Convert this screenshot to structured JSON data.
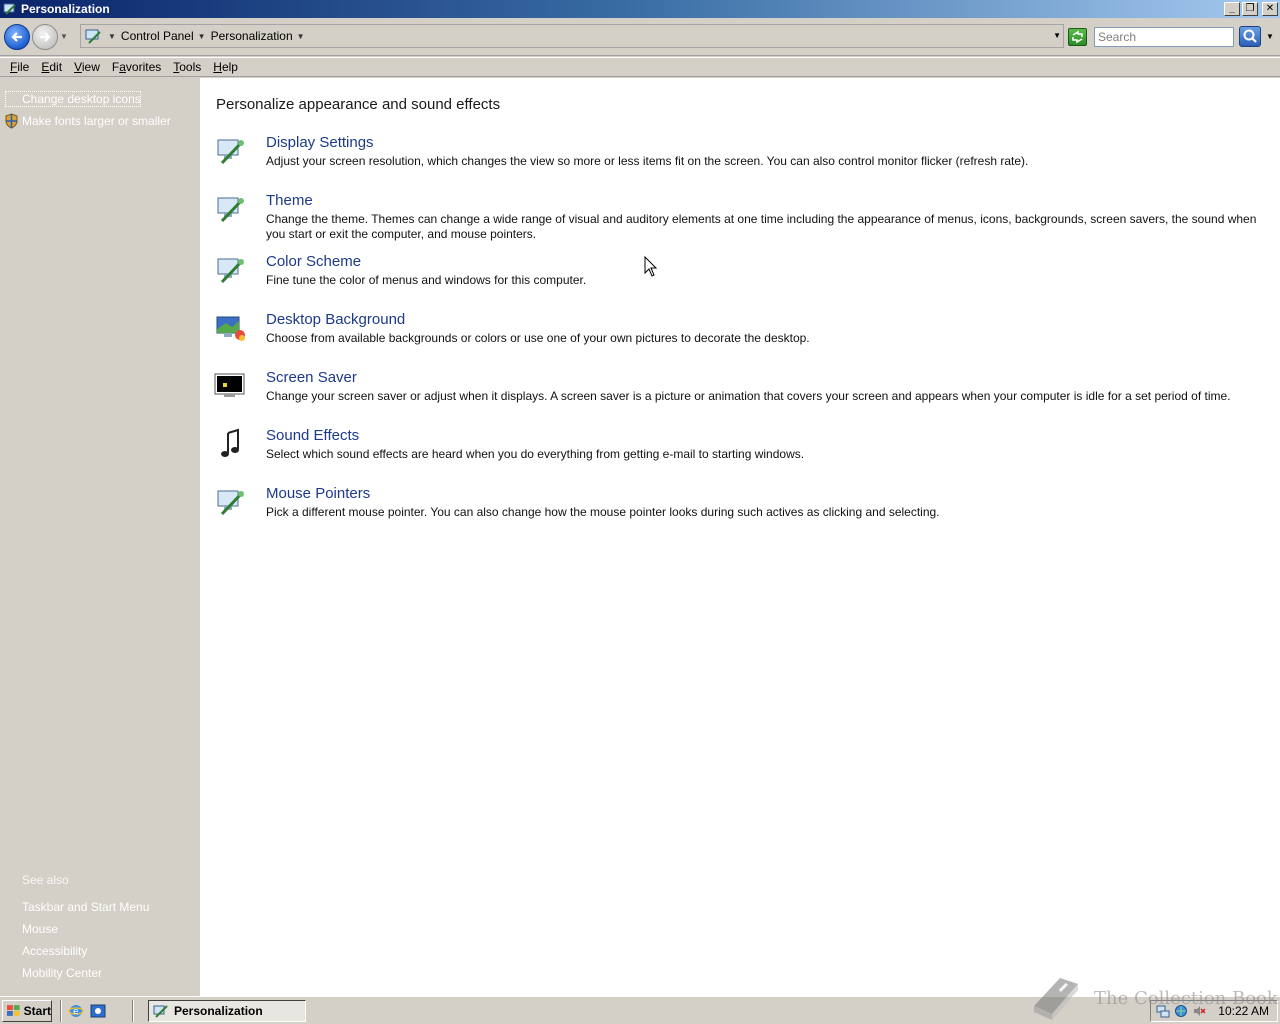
{
  "window": {
    "title": "Personalization"
  },
  "caption_buttons": {
    "minimize": "_",
    "restore": "❐",
    "close": "✕"
  },
  "address_bar": {
    "breadcrumbs": [
      "Control Panel",
      "Personalization"
    ],
    "search_placeholder": "Search"
  },
  "menu": {
    "items": [
      {
        "mnemonic": "F",
        "rest": "ile"
      },
      {
        "mnemonic": "E",
        "rest": "dit"
      },
      {
        "mnemonic": "V",
        "rest": "iew"
      },
      {
        "pre": "F",
        "mnemonic": "a",
        "rest": "vorites"
      },
      {
        "mnemonic": "T",
        "rest": "ools"
      },
      {
        "mnemonic": "H",
        "rest": "elp"
      }
    ]
  },
  "left_pane": {
    "tasks": [
      "Change desktop icons",
      "Make fonts larger or smaller"
    ],
    "see_also_heading": "See also",
    "see_also": [
      "Taskbar and Start Menu",
      "Mouse",
      "Accessibility",
      "Mobility Center"
    ]
  },
  "main": {
    "title": "Personalize appearance and sound effects",
    "items": [
      {
        "title": "Display Settings",
        "desc": "Adjust your screen resolution, which changes the view so more or less items fit on the screen. You can also control monitor flicker (refresh rate).",
        "icon": "display-settings-icon"
      },
      {
        "title": "Theme",
        "desc": "Change the theme. Themes can change a wide range of visual and auditory elements at one time including the appearance of menus, icons, backgrounds, screen savers, the sound when you start or exit the computer, and mouse pointers.",
        "icon": "theme-icon"
      },
      {
        "title": "Color Scheme",
        "desc": "Fine tune the color of menus and windows for this computer.",
        "icon": "color-scheme-icon"
      },
      {
        "title": "Desktop Background",
        "desc": "Choose from available backgrounds or colors or use one of your own pictures to decorate the desktop.",
        "icon": "desktop-background-icon"
      },
      {
        "title": "Screen Saver",
        "desc": "Change your screen saver or adjust when it displays. A screen saver is a picture or animation that covers your screen and appears when your computer is idle for a set period of time.",
        "icon": "screen-saver-icon"
      },
      {
        "title": "Sound Effects",
        "desc": "Select which sound effects are heard when you do everything from getting e-mail to starting windows.",
        "icon": "sound-effects-icon"
      },
      {
        "title": "Mouse Pointers",
        "desc": "Pick a different mouse pointer. You can also change how the mouse pointer looks during such actives as clicking and selecting.",
        "icon": "mouse-pointers-icon"
      }
    ]
  },
  "taskbar": {
    "start_label": "Start",
    "window_button": "Personalization",
    "clock": "10:22 AM"
  },
  "watermark": {
    "text": "The Collection Book"
  },
  "colors": {
    "title_bar_start": "#0a246a",
    "title_bar_end": "#a6caf0",
    "link": "#1c3a8a",
    "chrome": "#d4d0c8"
  }
}
